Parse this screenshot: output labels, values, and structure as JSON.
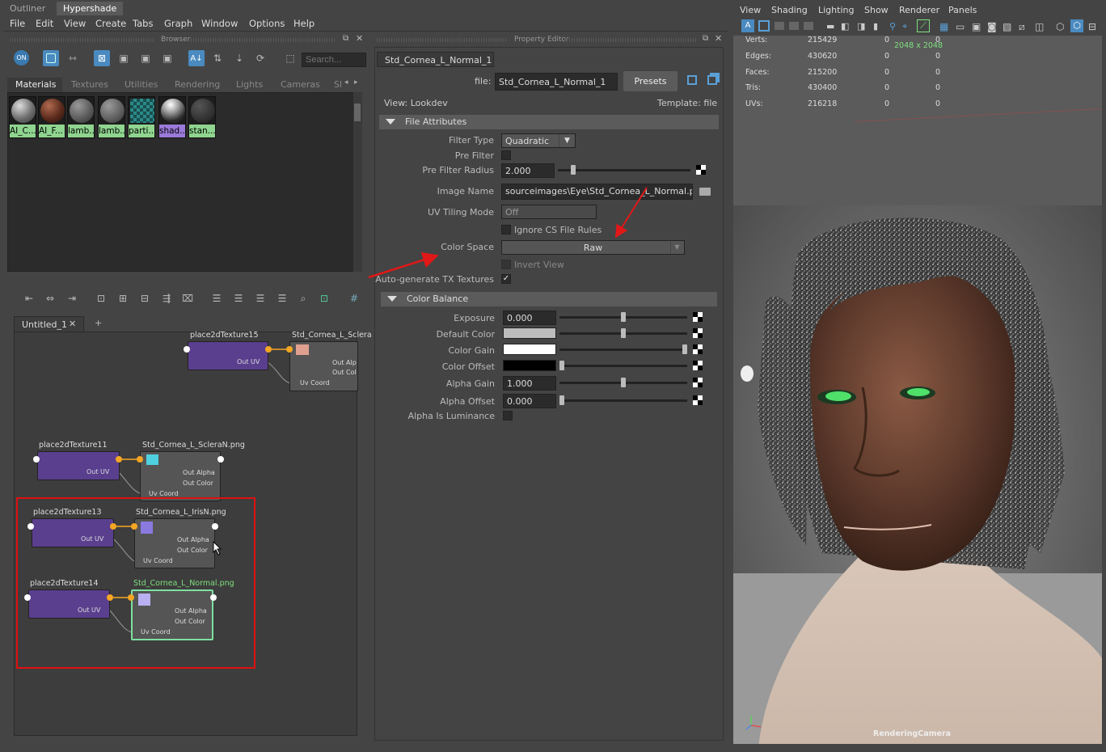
{
  "top_tabs": [
    "Outliner",
    "Hypershade"
  ],
  "menu": [
    "File",
    "Edit",
    "View",
    "Create",
    "Tabs",
    "Graph",
    "Window",
    "Options",
    "Help"
  ],
  "browser": {
    "title": "Browser",
    "search_placeholder": "Search...",
    "tabs": [
      "Materials",
      "Textures",
      "Utilities",
      "Rendering",
      "Lights",
      "Cameras",
      "Sl"
    ],
    "materials": [
      {
        "label": "AI_C...",
        "color": "#777777"
      },
      {
        "label": "AI_F...",
        "color": "#6a3020"
      },
      {
        "label": "lamb...",
        "color": "#6b6b6b"
      },
      {
        "label": "lamb...",
        "color": "#707070"
      },
      {
        "label": "parti...",
        "color": "#3aa0a0"
      },
      {
        "label": "shad...",
        "color": "#a0a0a0"
      },
      {
        "label": "stan...",
        "color": "#3b3b3b"
      }
    ]
  },
  "graph": {
    "tab": "Untitled_1",
    "add_tab": "+",
    "nodes": {
      "n15": {
        "place": "place2dTexture15",
        "file": "Std_Cornea_L_Sclera"
      },
      "n11": {
        "place": "place2dTexture11",
        "file": "Std_Cornea_L_ScleraN.png"
      },
      "n13": {
        "place": "place2dTexture13",
        "file": "Std_Cornea_L_IrisN.png"
      },
      "n14": {
        "place": "place2dTexture14",
        "file": "Std_Cornea_L_Normal.png"
      }
    },
    "out_uv": "Out UV",
    "out_alpha": "Out Alpha",
    "out_color": "Out Color",
    "uv_coord": "Uv Coord",
    "out_alpha_short": "Out Alp",
    "out_color_short": "Out Col"
  },
  "property_editor": {
    "title": "Property Editor",
    "tab": "Std_Cornea_L_Normal_1",
    "file_label": "file:",
    "file_value": "Std_Cornea_L_Normal_1",
    "presets": "Presets",
    "view_label": "View: Lookdev",
    "template_label": "Template: file",
    "file_attributes": {
      "header": "File Attributes",
      "filter_type_label": "Filter Type",
      "filter_type_value": "Quadratic",
      "pre_filter_label": "Pre Filter",
      "pre_filter_radius_label": "Pre Filter Radius",
      "pre_filter_radius_value": "2.000",
      "pre_filter_radius_level": 0.1,
      "image_name_label": "Image Name",
      "image_name_value": "sourceimages\\Eye\\Std_Cornea_L_Normal.png",
      "uv_tiling_label": "UV Tiling Mode",
      "uv_tiling_value": "Off",
      "ignore_cs_label": "Ignore CS File Rules",
      "color_space_label": "Color Space",
      "color_space_value": "Raw",
      "invert_view_label": "Invert View",
      "auto_tx_label": "Auto-generate TX Textures",
      "checkmark": "✓"
    },
    "color_balance": {
      "header": "Color Balance",
      "exposure_label": "Exposure",
      "exposure_value": "0.000",
      "exposure_level": 0.5,
      "default_color_label": "Default Color",
      "default_color": "#bcbcbc",
      "default_color_level": 0.5,
      "color_gain_label": "Color Gain",
      "color_gain": "#ffffff",
      "color_gain_level": 1.0,
      "color_offset_label": "Color Offset",
      "color_offset": "#000000",
      "color_offset_level": 0.0,
      "alpha_gain_label": "Alpha Gain",
      "alpha_gain_value": "1.000",
      "alpha_gain_level": 0.5,
      "alpha_offset_label": "Alpha Offset",
      "alpha_offset_value": "0.000",
      "alpha_offset_level": 0.0,
      "alpha_is_luminance_label": "Alpha Is Luminance"
    }
  },
  "viewport": {
    "menu": [
      "View",
      "Shading",
      "Lighting",
      "Show",
      "Renderer",
      "Panels"
    ],
    "hud": [
      {
        "label": "Verts:",
        "v1": "215429",
        "v2": "0",
        "v3": "0"
      },
      {
        "label": "Edges:",
        "v1": "430620",
        "v2": "0",
        "v3": "0"
      },
      {
        "label": "Faces:",
        "v1": "215200",
        "v2": "0",
        "v3": "0"
      },
      {
        "label": "Tris:",
        "v1": "430400",
        "v2": "0",
        "v3": "0"
      },
      {
        "label": "UVs:",
        "v1": "216218",
        "v2": "0",
        "v3": "0"
      }
    ],
    "resolution": "2048 x 2048",
    "camera": "RenderingCamera"
  },
  "colors": {
    "highlight_box": "#e01010",
    "arrow": "#e01818",
    "accent_blue": "#4a8ac0",
    "material_label_green": "#8fd48f",
    "node_purple": "#5a3f8e",
    "port_orange": "#f5a623"
  }
}
